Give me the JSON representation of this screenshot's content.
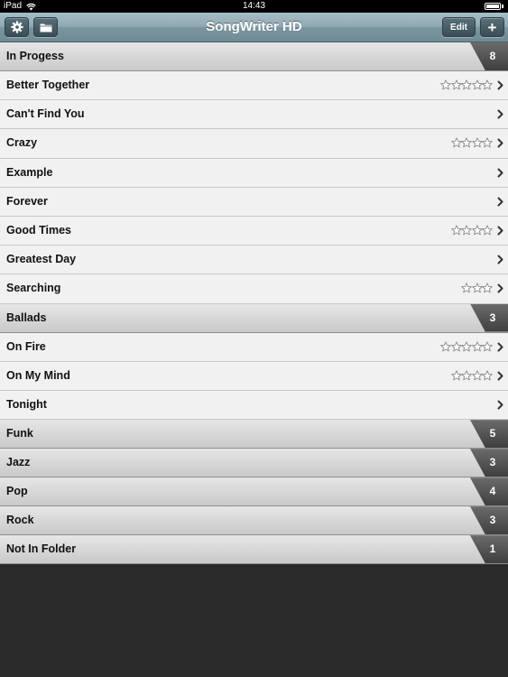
{
  "status_bar": {
    "carrier": "iPad",
    "time": "14:43",
    "battery_level": 1.0
  },
  "toolbar": {
    "title": "SongWriter HD",
    "edit_label": "Edit",
    "add_label": "+",
    "settings_icon": "gear-icon",
    "folder_icon": "folder-icon"
  },
  "folders": [
    {
      "name": "In Progess",
      "count": "8",
      "songs": [
        {
          "title": "Better Together",
          "stars": 5
        },
        {
          "title": "Can't Find You",
          "stars": 0
        },
        {
          "title": "Crazy",
          "stars": 4
        },
        {
          "title": "Example",
          "stars": 0
        },
        {
          "title": "Forever",
          "stars": 0
        },
        {
          "title": "Good Times",
          "stars": 4
        },
        {
          "title": "Greatest Day",
          "stars": 0
        },
        {
          "title": "Searching",
          "stars": 3
        }
      ]
    },
    {
      "name": "Ballads",
      "count": "3",
      "songs": [
        {
          "title": "On Fire",
          "stars": 5
        },
        {
          "title": "On My Mind",
          "stars": 4
        },
        {
          "title": "Tonight",
          "stars": 0
        }
      ]
    },
    {
      "name": "Funk",
      "count": "5",
      "songs": []
    },
    {
      "name": "Jazz",
      "count": "3",
      "songs": []
    },
    {
      "name": "Pop",
      "count": "4",
      "songs": []
    },
    {
      "name": "Rock",
      "count": "3",
      "songs": []
    },
    {
      "name": "Not In Folder",
      "count": "1",
      "songs": []
    }
  ],
  "colors": {
    "toolbar": "#8ea8b2",
    "folder_tab": "#4f4f4f",
    "background": "#2a2a2a",
    "row": "#f1f1f1"
  }
}
